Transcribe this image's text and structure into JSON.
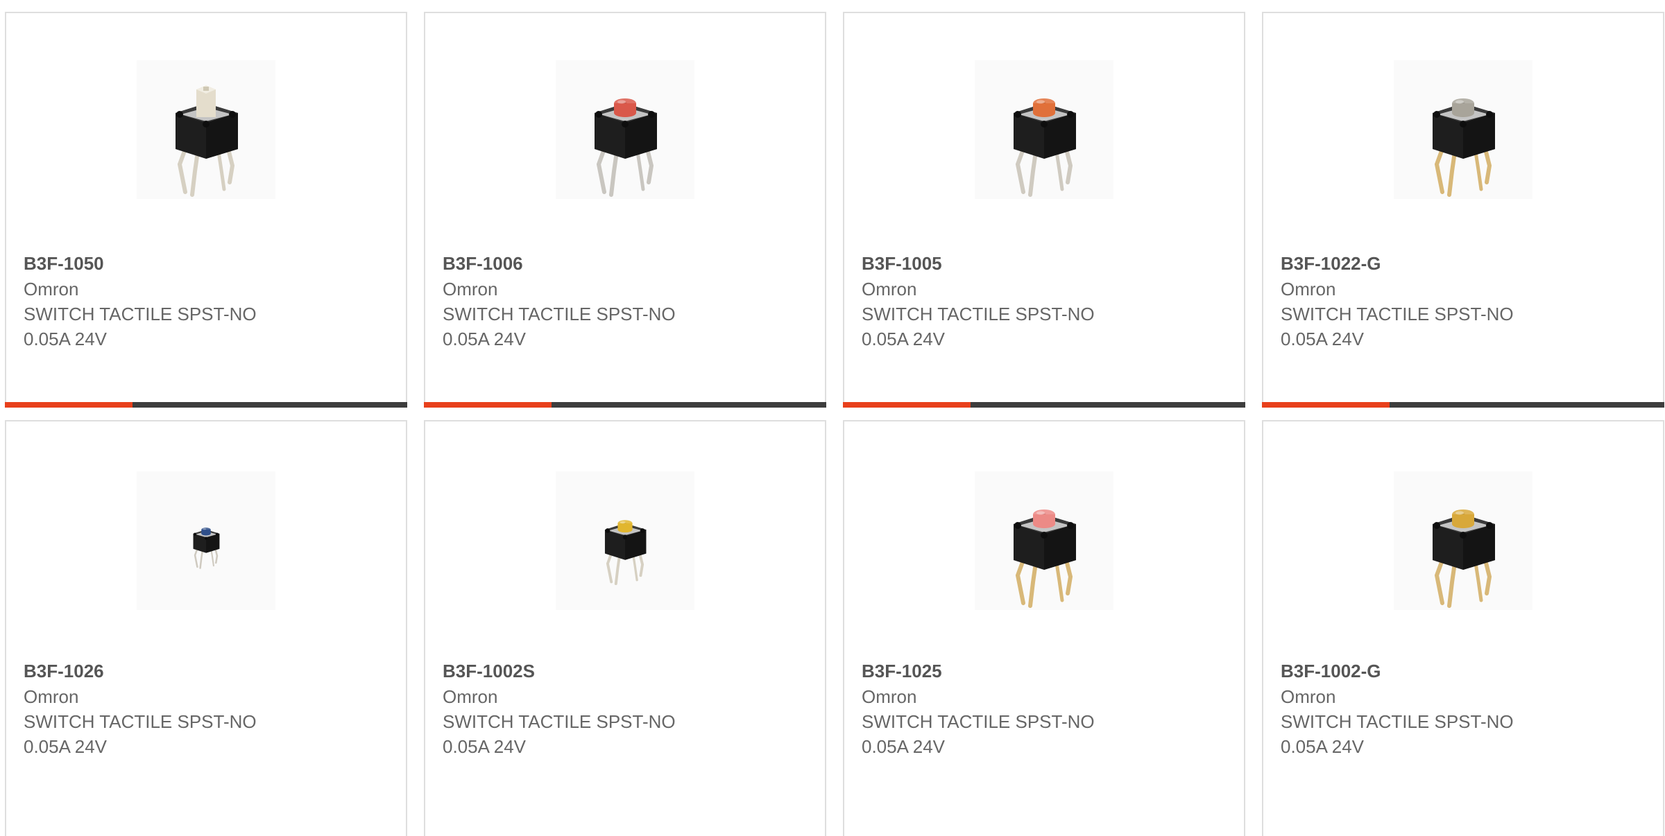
{
  "colors": {
    "accent": "#e8401c",
    "bar_dark": "#3d3d3d",
    "card_border": "#dedede",
    "text": "#666666"
  },
  "products": [
    {
      "part_number": "B3F-1050",
      "manufacturer": "Omron",
      "description_line1": "SWITCH TACTILE SPST-NO",
      "description_line2": "0.05A 24V",
      "cap_color": "#e4ddcc",
      "cap_shape": "tall-square",
      "lead_color": "#d6d0c2",
      "image_icon": "tactile-switch-icon"
    },
    {
      "part_number": "B3F-1006",
      "manufacturer": "Omron",
      "description_line1": "SWITCH TACTILE SPST-NO",
      "description_line2": "0.05A 24V",
      "cap_color": "#d9584a",
      "cap_shape": "round",
      "lead_color": "#c9c6c0",
      "image_icon": "tactile-switch-icon"
    },
    {
      "part_number": "B3F-1005",
      "manufacturer": "Omron",
      "description_line1": "SWITCH TACTILE SPST-NO",
      "description_line2": "0.05A 24V",
      "cap_color": "#e0703a",
      "cap_shape": "round",
      "lead_color": "#cfcac0",
      "image_icon": "tactile-switch-icon"
    },
    {
      "part_number": "B3F-1022-G",
      "manufacturer": "Omron",
      "description_line1": "SWITCH TACTILE SPST-NO",
      "description_line2": "0.05A 24V",
      "cap_color": "#a8a49a",
      "cap_shape": "round",
      "lead_color": "#d8b878",
      "image_icon": "tactile-switch-icon"
    },
    {
      "part_number": "B3F-1026",
      "manufacturer": "Omron",
      "description_line1": "SWITCH TACTILE SPST-NO",
      "description_line2": "0.05A 24V",
      "cap_color": "#2f4f8a",
      "cap_shape": "small",
      "lead_color": "#cfcac0",
      "image_icon": "tactile-switch-icon"
    },
    {
      "part_number": "B3F-1002S",
      "manufacturer": "Omron",
      "description_line1": "SWITCH TACTILE SPST-NO",
      "description_line2": "0.05A 24V",
      "cap_color": "#e1b62f",
      "cap_shape": "round-medium",
      "lead_color": "#d6d0c2",
      "image_icon": "tactile-switch-icon"
    },
    {
      "part_number": "B3F-1025",
      "manufacturer": "Omron",
      "description_line1": "SWITCH TACTILE SPST-NO",
      "description_line2": "0.05A 24V",
      "cap_color": "#ec8a86",
      "cap_shape": "round",
      "lead_color": "#d8b878",
      "image_icon": "tactile-switch-icon"
    },
    {
      "part_number": "B3F-1002-G",
      "manufacturer": "Omron",
      "description_line1": "SWITCH TACTILE SPST-NO",
      "description_line2": "0.05A 24V",
      "cap_color": "#d8a83a",
      "cap_shape": "round",
      "lead_color": "#d8b878",
      "image_icon": "tactile-switch-icon"
    }
  ]
}
